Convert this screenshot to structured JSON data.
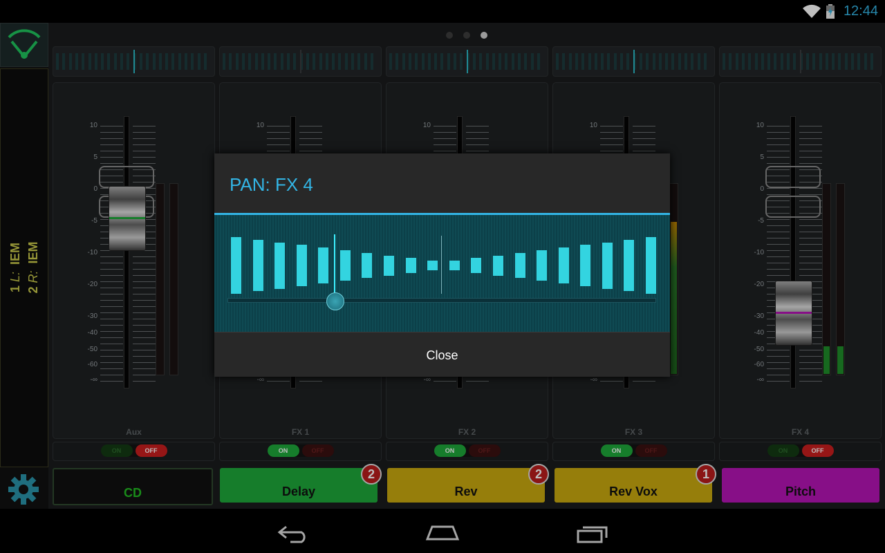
{
  "status": {
    "time": "12:44"
  },
  "leftbar": {
    "line1_num": "1",
    "line1_side": "L:",
    "line1_label": "IEM",
    "line2_num": "2",
    "line2_side": "R:",
    "line2_label": "IEM"
  },
  "scale_labels": [
    "10",
    "5",
    "0",
    "-5",
    "-10",
    "-20",
    "-30",
    "-40",
    "-50",
    "-60",
    "-∞"
  ],
  "channels": [
    {
      "name": "Aux",
      "on": false,
      "fx": "CD",
      "fx_color": "#111",
      "fx_text_color": "#22bb22",
      "badge": ""
    },
    {
      "name": "FX 1",
      "on": true,
      "fx": "Delay",
      "fx_color": "#1ea73a",
      "fx_text_color": "#111",
      "badge": "2"
    },
    {
      "name": "FX 2",
      "on": true,
      "fx": "Rev",
      "fx_color": "#c9a90f",
      "fx_text_color": "#111",
      "badge": "2"
    },
    {
      "name": "FX 3",
      "on": true,
      "fx": "Rev Vox",
      "fx_color": "#c9a90f",
      "fx_text_color": "#111",
      "badge": "1"
    },
    {
      "name": "FX 4",
      "on": false,
      "fx": "Pitch",
      "fx_color": "#b514b5",
      "fx_text_color": "#111",
      "badge": ""
    }
  ],
  "toggle": {
    "on_label": "ON",
    "off_label": "OFF"
  },
  "dialog": {
    "title": "PAN: FX 4",
    "close_label": "Close",
    "pan_value": -0.5
  },
  "colors": {
    "accent": "#33b5e5",
    "pan_bar": "#33d4e0"
  }
}
